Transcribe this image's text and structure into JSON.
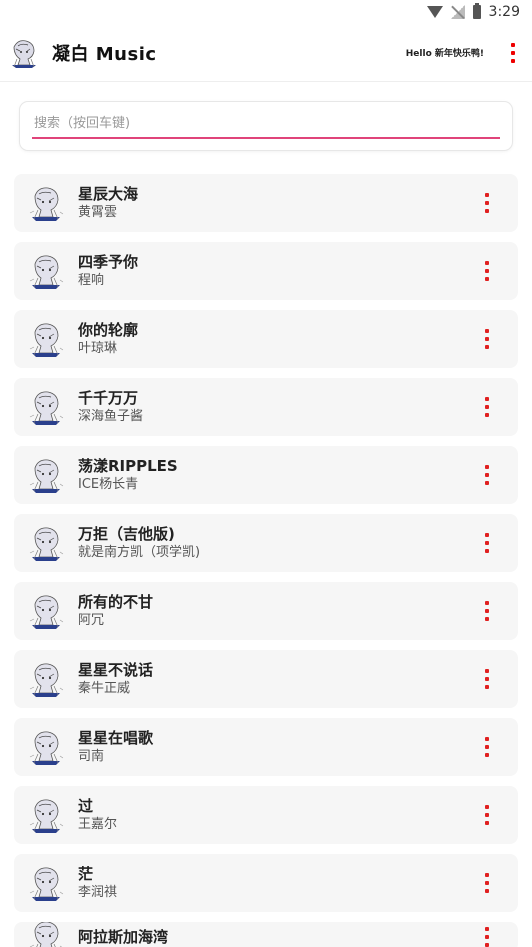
{
  "status_bar": {
    "time": "3:29",
    "icons": [
      "wifi-icon",
      "signal-off-icon",
      "battery-icon"
    ]
  },
  "app_bar": {
    "logo_icon": "anime-avatar-logo",
    "title": "凝白 Music",
    "greeting": "Hello 新年快乐鸭!",
    "menu_icon": "more-vertical-icon"
  },
  "search": {
    "placeholder": "搜索（按回车键)",
    "value": ""
  },
  "colors": {
    "accent": "#e0447a",
    "menu_red": "#e02020",
    "item_bg": "#f6f6f6"
  },
  "songs": [
    {
      "title": "星辰大海",
      "artist": "黄霄雲"
    },
    {
      "title": "四季予你",
      "artist": "程响"
    },
    {
      "title": "你的轮廓",
      "artist": "叶琼琳"
    },
    {
      "title": "千千万万",
      "artist": "深海鱼子酱"
    },
    {
      "title": "荡漾RIPPLES",
      "artist": "ICE杨长青"
    },
    {
      "title": "万拒（吉他版)",
      "artist": "就是南方凯（项学凯)"
    },
    {
      "title": "所有的不甘",
      "artist": "阿冗"
    },
    {
      "title": "星星不说话",
      "artist": "秦牛正威"
    },
    {
      "title": "星星在唱歌",
      "artist": "司南"
    },
    {
      "title": "过",
      "artist": "王嘉尔"
    },
    {
      "title": "茫",
      "artist": "李润祺"
    },
    {
      "title": "阿拉斯加海湾",
      "artist": ""
    }
  ]
}
